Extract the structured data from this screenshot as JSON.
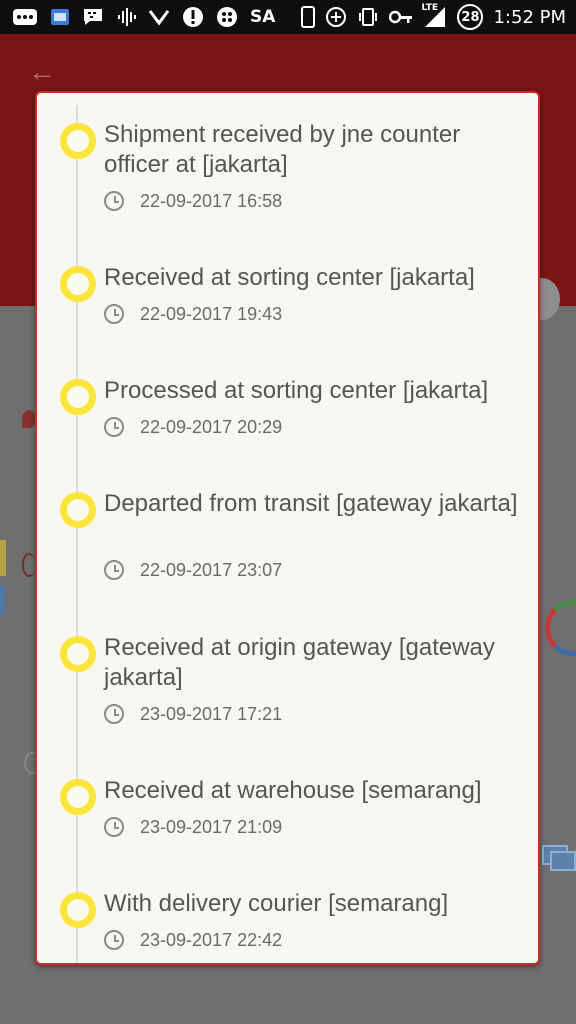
{
  "status_bar": {
    "carrier_label": "SA",
    "network_label": "LTE",
    "notification_count": "28",
    "time": "1:52 PM"
  },
  "tracking": {
    "accent_color": "#fbe43c",
    "dialog_border_color": "#c92a2a",
    "events": [
      {
        "title": "Shipment received by jne counter officer at [jakarta]",
        "timestamp": "22-09-2017 16:58"
      },
      {
        "title": "Received at sorting center [jakarta]",
        "timestamp": "22-09-2017 19:43"
      },
      {
        "title": "Processed at sorting center [jakarta]",
        "timestamp": "22-09-2017 20:29"
      },
      {
        "title": "Departed from transit [gateway jakarta]",
        "timestamp": "22-09-2017 23:07"
      },
      {
        "title": "Received at origin gateway [gateway jakarta]",
        "timestamp": "23-09-2017 17:21"
      },
      {
        "title": "Received at warehouse [semarang]",
        "timestamp": "23-09-2017 21:09"
      },
      {
        "title": "With delivery courier [semarang]",
        "timestamp": "23-09-2017 22:42"
      }
    ]
  }
}
